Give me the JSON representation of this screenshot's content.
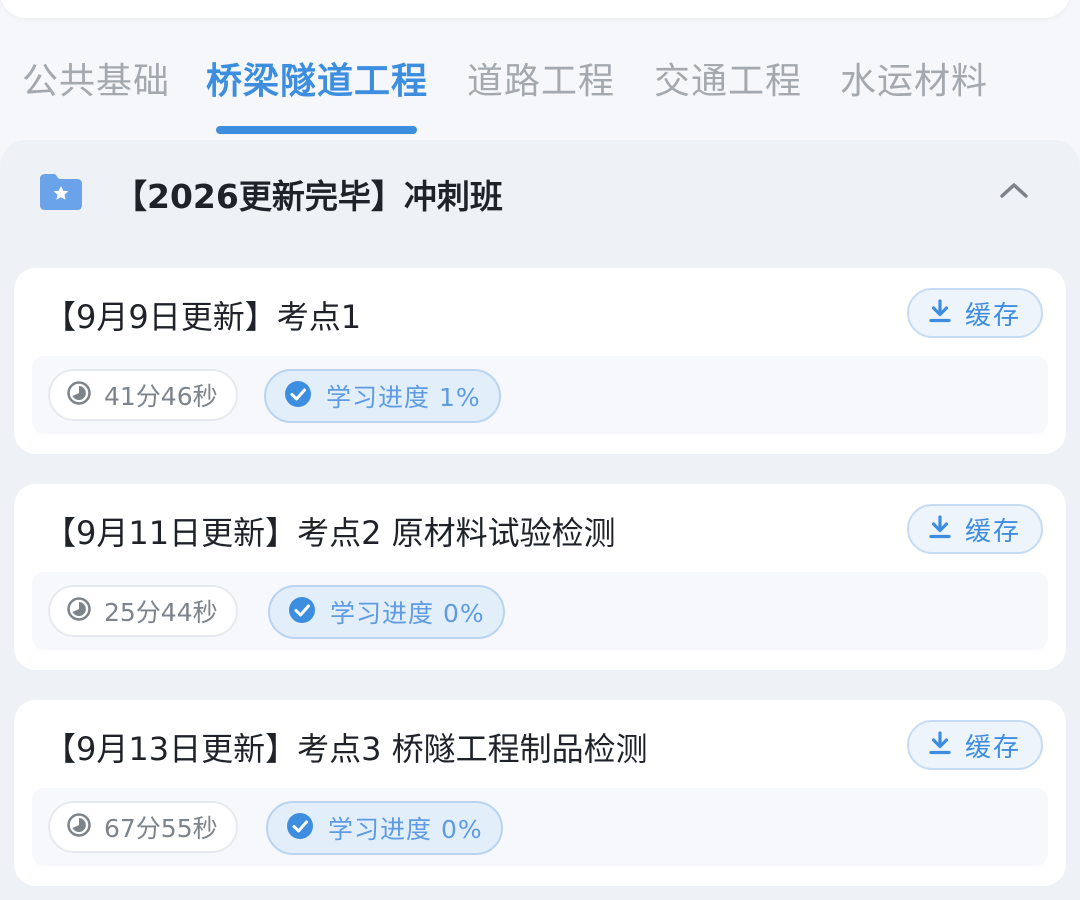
{
  "tabs": [
    {
      "label": "公共基础",
      "active": false
    },
    {
      "label": "桥梁隧道工程",
      "active": true
    },
    {
      "label": "道路工程",
      "active": false
    },
    {
      "label": "交通工程",
      "active": false
    },
    {
      "label": "水运材料",
      "active": false
    }
  ],
  "section": {
    "title": "【2026更新完毕】冲刺班",
    "icon": "folder-star-icon",
    "expanded": true
  },
  "lessons": [
    {
      "title": "【9月9日更新】考点1",
      "cache_label": "缓存",
      "duration": "41分46秒",
      "progress": "学习进度 1%"
    },
    {
      "title": "【9月11日更新】考点2 原材料试验检测",
      "cache_label": "缓存",
      "duration": "25分44秒",
      "progress": "学习进度 0%"
    },
    {
      "title": "【9月13日更新】考点3 桥隧工程制品检测",
      "cache_label": "缓存",
      "duration": "67分55秒",
      "progress": "学习进度 0%"
    }
  ],
  "colors": {
    "accent": "#3e8ee0",
    "tab_inactive": "#a4a9b0",
    "background": "#f5f7fa"
  }
}
